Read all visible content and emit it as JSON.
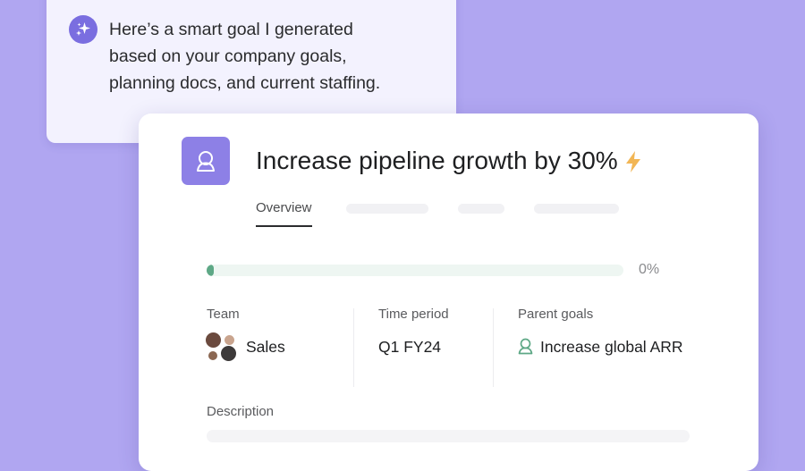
{
  "assistant": {
    "icon": "sparkle-icon",
    "accent": "#7a6ee0",
    "message_lines": [
      "Here’s a smart goal I generated",
      "based on your company goals,",
      "planning docs, and current staffing."
    ]
  },
  "goal": {
    "icon": "goal-person-icon",
    "title": "Increase pipeline growth by 30%",
    "badge_icon": "lightning-bolt-icon",
    "badge_color": "#f2b655",
    "tabs": [
      {
        "label": "Overview",
        "active": true
      }
    ],
    "progress": {
      "value": 0,
      "label": "0%",
      "color": "#5ea886"
    },
    "fields": {
      "team": {
        "label": "Team",
        "value": "Sales"
      },
      "time_period": {
        "label": "Time period",
        "value": "Q1 FY24"
      },
      "parent_goals": {
        "label": "Parent goals",
        "value": "Increase global ARR",
        "icon": "goal-person-icon"
      }
    },
    "description": {
      "label": "Description"
    }
  },
  "colors": {
    "background": "#b0a6f1",
    "goal_icon_bg": "#8d80e6"
  }
}
